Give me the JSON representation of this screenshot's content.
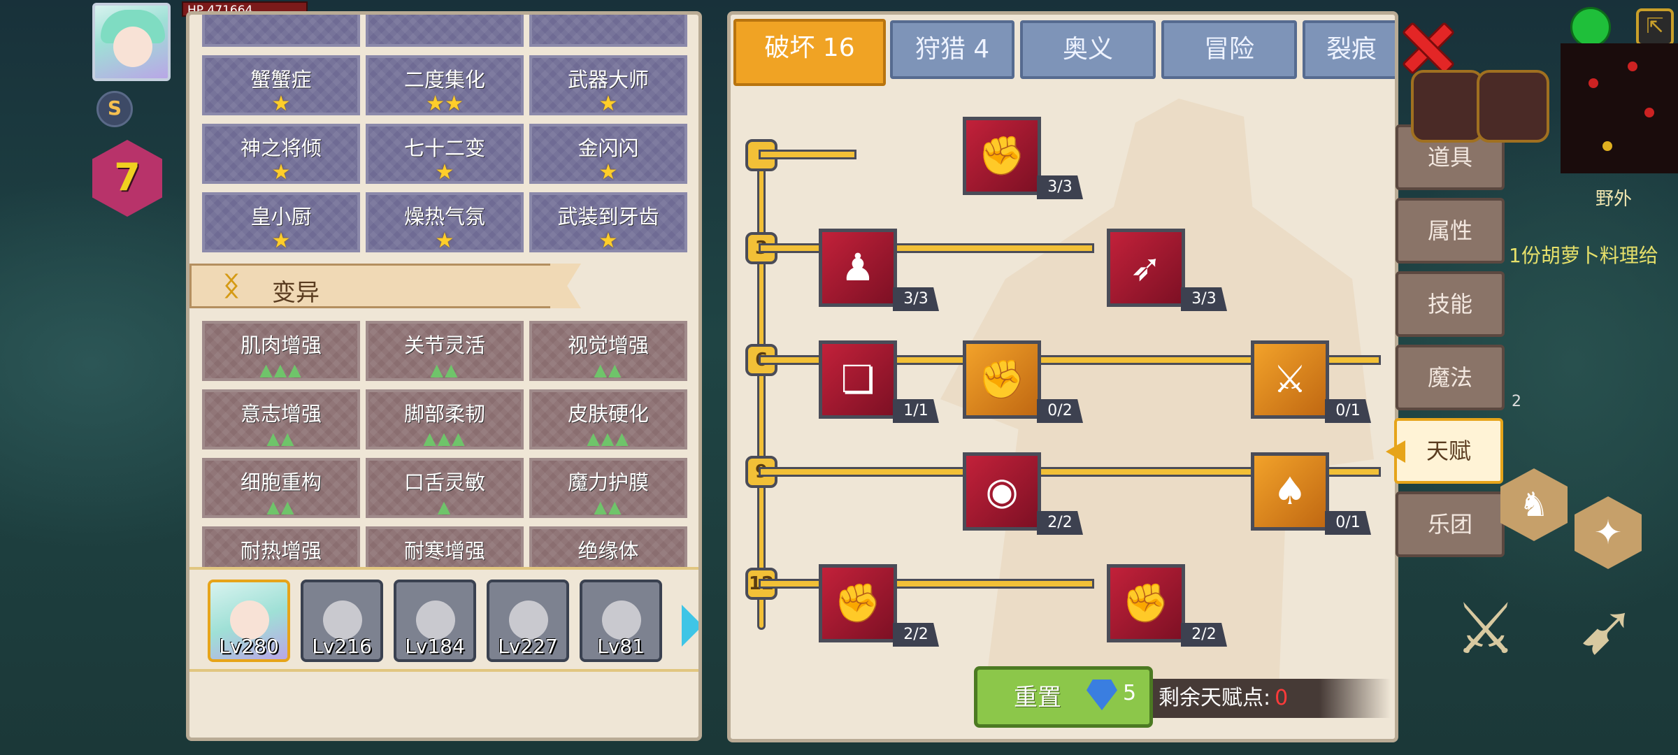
{
  "hud": {
    "hp_label": "HP",
    "hp_value": "471664",
    "level": "7",
    "player_level_partial": "2"
  },
  "skills": [
    {
      "name": "蟹蟹症",
      "stars": "★"
    },
    {
      "name": "二度集化",
      "stars": "★★"
    },
    {
      "name": "武器大师",
      "stars": "★"
    },
    {
      "name": "神之将倾",
      "stars": "★"
    },
    {
      "name": "七十二变",
      "stars": "★"
    },
    {
      "name": "金闪闪",
      "stars": "★"
    },
    {
      "name": "皇小厨",
      "stars": "★"
    },
    {
      "name": "燥热气氛",
      "stars": "★"
    },
    {
      "name": "武装到牙齿",
      "stars": "★"
    }
  ],
  "mutation_banner": "变异",
  "mutations": [
    {
      "name": "肌肉增强",
      "level": "▲▲▲"
    },
    {
      "name": "关节灵活",
      "level": "▲▲"
    },
    {
      "name": "视觉增强",
      "level": "▲▲"
    },
    {
      "name": "意志增强",
      "level": "▲▲"
    },
    {
      "name": "脚部柔韧",
      "level": "▲▲▲"
    },
    {
      "name": "皮肤硬化",
      "level": "▲▲▲"
    },
    {
      "name": "细胞重构",
      "level": "▲▲"
    },
    {
      "name": "口舌灵敏",
      "level": "▲"
    },
    {
      "name": "魔力护膜",
      "level": "▲▲"
    },
    {
      "name": "耐热增强",
      "level": ""
    },
    {
      "name": "耐寒增强",
      "level": ""
    },
    {
      "name": "绝缘体",
      "level": ""
    }
  ],
  "heroes": [
    {
      "level": "Lv280",
      "selected": true
    },
    {
      "level": "Lv216",
      "selected": false
    },
    {
      "level": "Lv184",
      "selected": false
    },
    {
      "level": "Lv227",
      "selected": false
    },
    {
      "level": "Lv81",
      "selected": false
    }
  ],
  "tabs": [
    {
      "label": "破坏 16",
      "active": true
    },
    {
      "label": "狩猎 4",
      "active": false
    },
    {
      "label": "奥义",
      "active": false
    },
    {
      "label": "冒险",
      "active": false
    },
    {
      "label": "裂痕",
      "active": false
    }
  ],
  "tier_labels": [
    "3",
    "6",
    "9",
    "12"
  ],
  "talents": [
    {
      "icon": "arm-wrestle-icon",
      "symbol": "✊",
      "count": "3/3",
      "color": "red"
    },
    {
      "icon": "body-icon",
      "symbol": "♟",
      "count": "3/3",
      "color": "red"
    },
    {
      "icon": "arrow-icon",
      "symbol": "➶",
      "count": "3/3",
      "color": "red"
    },
    {
      "icon": "card-icon",
      "symbol": "❏",
      "count": "1/1",
      "color": "red"
    },
    {
      "icon": "punch-icon",
      "symbol": "✊",
      "count": "0/2",
      "color": "orange"
    },
    {
      "icon": "sword-splash-icon",
      "symbol": "⚔",
      "count": "0/1",
      "color": "orange"
    },
    {
      "icon": "ripple-icon",
      "symbol": "◉",
      "count": "2/2",
      "color": "red"
    },
    {
      "icon": "bat-icon",
      "symbol": "♠",
      "count": "0/1",
      "color": "orange"
    },
    {
      "icon": "fist-icon",
      "symbol": "✊",
      "count": "2/2",
      "color": "red"
    },
    {
      "icon": "fist-slash-icon",
      "symbol": "✊",
      "count": "2/2",
      "color": "red"
    }
  ],
  "reset": {
    "label": "重置",
    "cost": "5"
  },
  "remaining_points": {
    "label": "剩余天赋点:",
    "value": "0"
  },
  "side_menu": [
    {
      "label": "道具",
      "active": false
    },
    {
      "label": "属性",
      "active": false
    },
    {
      "label": "技能",
      "active": false
    },
    {
      "label": "魔法",
      "active": false
    },
    {
      "label": "天赋",
      "active": true
    },
    {
      "label": "乐团",
      "active": false
    }
  ],
  "right_hud": {
    "area_label": "野外",
    "quest_text": "1份胡萝卜料理给",
    "small_count": "2"
  }
}
